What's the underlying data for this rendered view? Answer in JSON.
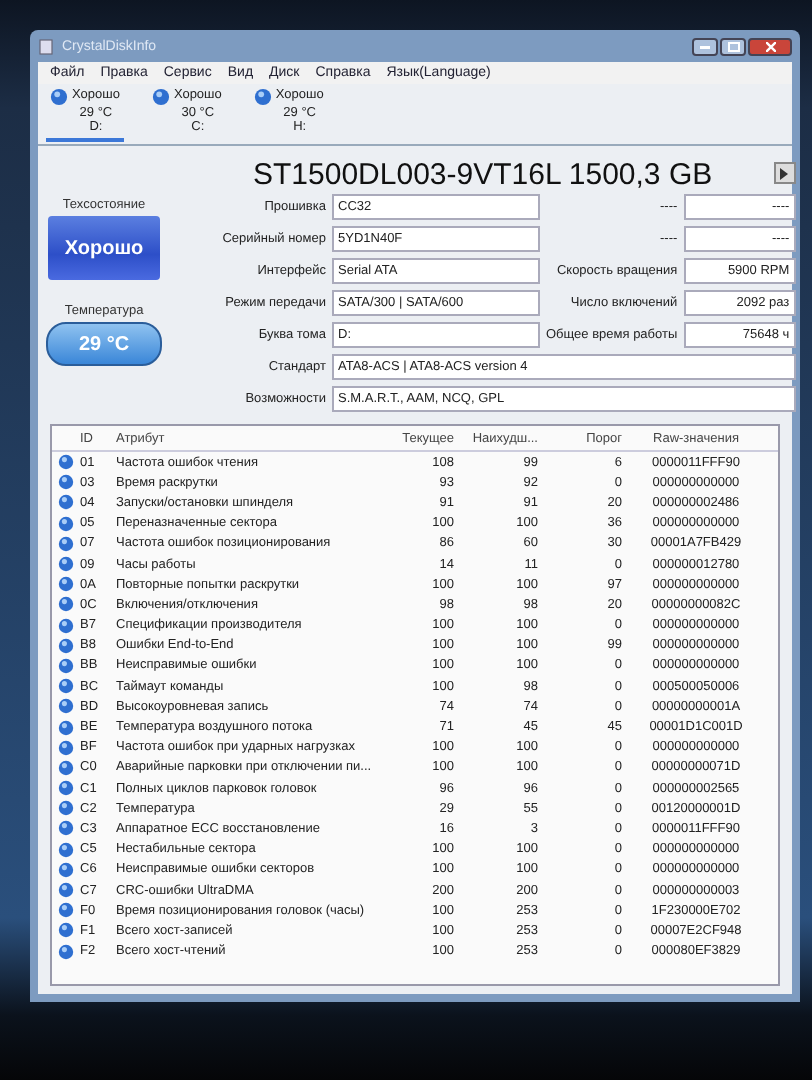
{
  "window": {
    "title": "CrystalDiskInfo"
  },
  "menu": [
    "Файл",
    "Правка",
    "Сервис",
    "Вид",
    "Диск",
    "Справка",
    "Язык(Language)"
  ],
  "disks": [
    {
      "status": "Хорошо",
      "temp": "29 °C",
      "letter": "D:",
      "selected": true
    },
    {
      "status": "Хорошо",
      "temp": "30 °C",
      "letter": "C:",
      "selected": false
    },
    {
      "status": "Хорошо",
      "temp": "29 °C",
      "letter": "H:",
      "selected": false
    }
  ],
  "model": "ST1500DL003-9VT16L 1500,3 GB",
  "health": {
    "label": "Техсостояние",
    "value": "Хорошо"
  },
  "temperature": {
    "label": "Температура",
    "value": "29 °C"
  },
  "info": [
    {
      "label": "Прошивка",
      "value": "CC32",
      "right_label": "----",
      "right_value": "----"
    },
    {
      "label": "Серийный номер",
      "value": "5YD1N40F",
      "right_label": "----",
      "right_value": "----"
    },
    {
      "label": "Интерфейс",
      "value": "Serial ATA",
      "right_label": "Скорость вращения",
      "right_value": "5900 RPM"
    },
    {
      "label": "Режим передачи",
      "value": "SATA/300 | SATA/600",
      "right_label": "Число включений",
      "right_value": "2092 раз"
    },
    {
      "label": "Буква тома",
      "value": "D:",
      "right_label": "Общее время работы",
      "right_value": "75648 ч"
    },
    {
      "label": "Стандарт",
      "value": "ATA8-ACS | ATA8-ACS version 4"
    },
    {
      "label": "Возможности",
      "value": "S.M.A.R.T., AAM, NCQ, GPL"
    }
  ],
  "table": {
    "columns": [
      "ID",
      "Атрибут",
      "Текущее",
      "Наихудш...",
      "Порог",
      "Raw-значения"
    ],
    "rows": [
      [
        "01",
        "Частота ошибок чтения",
        "108",
        "99",
        "6",
        "0000011FFF90"
      ],
      [
        "03",
        "Время раскрутки",
        "93",
        "92",
        "0",
        "000000000000"
      ],
      [
        "04",
        "Запуски/остановки шпинделя",
        "91",
        "91",
        "20",
        "000000002486"
      ],
      [
        "05",
        "Переназначенные сектора",
        "100",
        "100",
        "36",
        "000000000000"
      ],
      [
        "07",
        "Частота ошибок позиционирования",
        "86",
        "60",
        "30",
        "00001A7FB429"
      ],
      [
        "09",
        "Часы работы",
        "14",
        "11",
        "0",
        "000000012780"
      ],
      [
        "0A",
        "Повторные попытки раскрутки",
        "100",
        "100",
        "97",
        "000000000000"
      ],
      [
        "0C",
        "Включения/отключения",
        "98",
        "98",
        "20",
        "00000000082C"
      ],
      [
        "B7",
        "Спецификации производителя",
        "100",
        "100",
        "0",
        "000000000000"
      ],
      [
        "B8",
        "Ошибки End-to-End",
        "100",
        "100",
        "99",
        "000000000000"
      ],
      [
        "BB",
        "Неисправимые ошибки",
        "100",
        "100",
        "0",
        "000000000000"
      ],
      [
        "BC",
        "Таймаут команды",
        "100",
        "98",
        "0",
        "000500050006"
      ],
      [
        "BD",
        "Высокоуровневая запись",
        "74",
        "74",
        "0",
        "00000000001A"
      ],
      [
        "BE",
        "Температура воздушного потока",
        "71",
        "45",
        "45",
        "00001D1C001D"
      ],
      [
        "BF",
        "Частота ошибок при ударных нагрузках",
        "100",
        "100",
        "0",
        "000000000000"
      ],
      [
        "C0",
        "Аварийные парковки при отключении пи...",
        "100",
        "100",
        "0",
        "00000000071D"
      ],
      [
        "C1",
        "Полных циклов парковок головок",
        "96",
        "96",
        "0",
        "000000002565"
      ],
      [
        "C2",
        "Температура",
        "29",
        "55",
        "0",
        "00120000001D"
      ],
      [
        "C3",
        "Аппаратное ECC восстановление",
        "16",
        "3",
        "0",
        "0000011FFF90"
      ],
      [
        "C5",
        "Нестабильные сектора",
        "100",
        "100",
        "0",
        "000000000000"
      ],
      [
        "C6",
        "Неисправимые ошибки секторов",
        "100",
        "100",
        "0",
        "000000000000"
      ],
      [
        "C7",
        "CRC-ошибки UltraDMA",
        "200",
        "200",
        "0",
        "000000000003"
      ],
      [
        "F0",
        "Время позиционирования головок (часы)",
        "100",
        "253",
        "0",
        "1F230000E702"
      ],
      [
        "F1",
        "Всего хост-записей",
        "100",
        "253",
        "0",
        "00007E2CF948"
      ],
      [
        "F2",
        "Всего хост-чтений",
        "100",
        "253",
        "0",
        "000080EF3829"
      ]
    ]
  }
}
